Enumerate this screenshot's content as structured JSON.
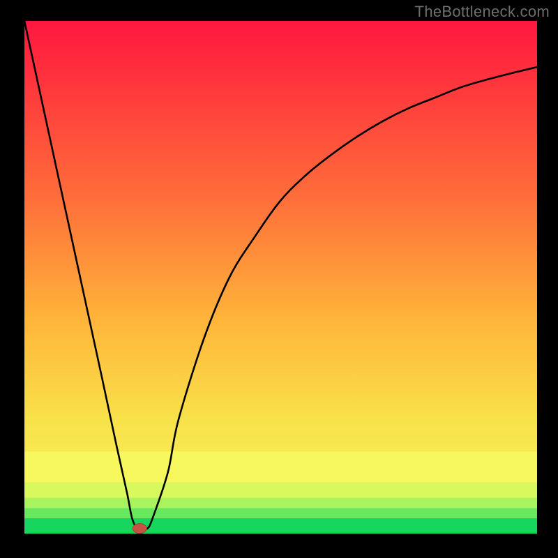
{
  "watermark": "TheBottleneck.com",
  "chart_data": {
    "type": "line",
    "title": "",
    "xlabel": "",
    "ylabel": "",
    "xlim": [
      0,
      100
    ],
    "ylim": [
      0,
      100
    ],
    "grid": false,
    "x": [
      0,
      5,
      10,
      15,
      18,
      20,
      21,
      22,
      23,
      24,
      25,
      28,
      30,
      35,
      40,
      45,
      50,
      55,
      60,
      65,
      70,
      75,
      80,
      85,
      90,
      95,
      100
    ],
    "values": [
      100,
      77,
      54,
      31,
      17,
      8,
      3,
      1,
      1,
      1,
      3,
      12,
      22,
      38,
      50,
      58,
      65,
      70,
      74,
      77.5,
      80.5,
      83,
      85,
      87,
      88.5,
      89.8,
      91
    ],
    "marker": {
      "x": 22.5,
      "y": 1
    },
    "bands": [
      {
        "from": 0,
        "to": 3,
        "color": "#17d65e"
      },
      {
        "from": 3,
        "to": 5,
        "color": "#69e85e"
      },
      {
        "from": 5,
        "to": 7,
        "color": "#a8f35e"
      },
      {
        "from": 7,
        "to": 10,
        "color": "#d9f85e"
      },
      {
        "from": 10,
        "to": 16,
        "color": "#f6f85e"
      }
    ]
  },
  "gradient": {
    "top": "#ff173e",
    "mid_upper": "#ff6f3a",
    "mid": "#ffb43a",
    "mid_lower": "#f8e24a",
    "band_yellow": "#f6f85e",
    "band_lime": "#a8f35e",
    "band_green": "#17d65e",
    "line": "#000000",
    "marker_fill": "#c65246",
    "marker_stroke": "#b23a30",
    "frame": "#000000"
  }
}
